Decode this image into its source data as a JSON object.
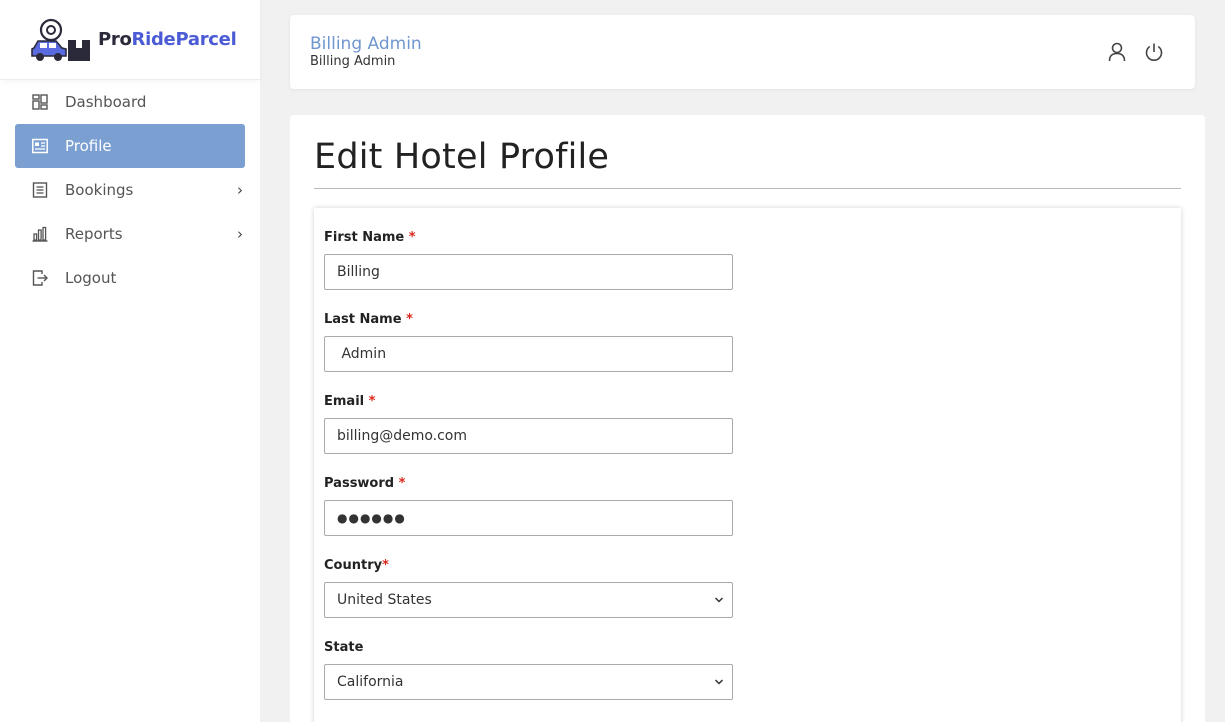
{
  "brand": {
    "pro": "Pro",
    "rideparcel": "RideParcel"
  },
  "sidebar": {
    "items": [
      {
        "label": "Dashboard",
        "icon": "dashboard-icon",
        "active": false,
        "chevron": ""
      },
      {
        "label": "Profile",
        "icon": "profile-card-icon",
        "active": true,
        "chevron": ""
      },
      {
        "label": "Bookings",
        "icon": "list-icon",
        "active": false,
        "chevron": "›"
      },
      {
        "label": "Reports",
        "icon": "bar-chart-icon",
        "active": false,
        "chevron": "›"
      },
      {
        "label": "Logout",
        "icon": "logout-icon",
        "active": false,
        "chevron": ""
      }
    ]
  },
  "header": {
    "title": "Billing Admin",
    "subtitle": "Billing Admin"
  },
  "page": {
    "title": "Edit Hotel Profile"
  },
  "form": {
    "first_name": {
      "label": "First Name",
      "required": "*",
      "value": "Billing"
    },
    "last_name": {
      "label": "Last Name",
      "required": "*",
      "value": " Admin"
    },
    "email": {
      "label": "Email",
      "required": "*",
      "value": "billing@demo.com"
    },
    "password": {
      "label": "Password",
      "required": "*",
      "value": "●●●●●●"
    },
    "country": {
      "label": "Country",
      "required": "*",
      "value": "United States"
    },
    "state": {
      "label": "State",
      "required": "",
      "value": "California"
    }
  },
  "colors": {
    "accent": "#7a9fd0",
    "brand_blue": "#4b5bd6",
    "required": "#d9261c",
    "header_title": "#7096cf"
  }
}
